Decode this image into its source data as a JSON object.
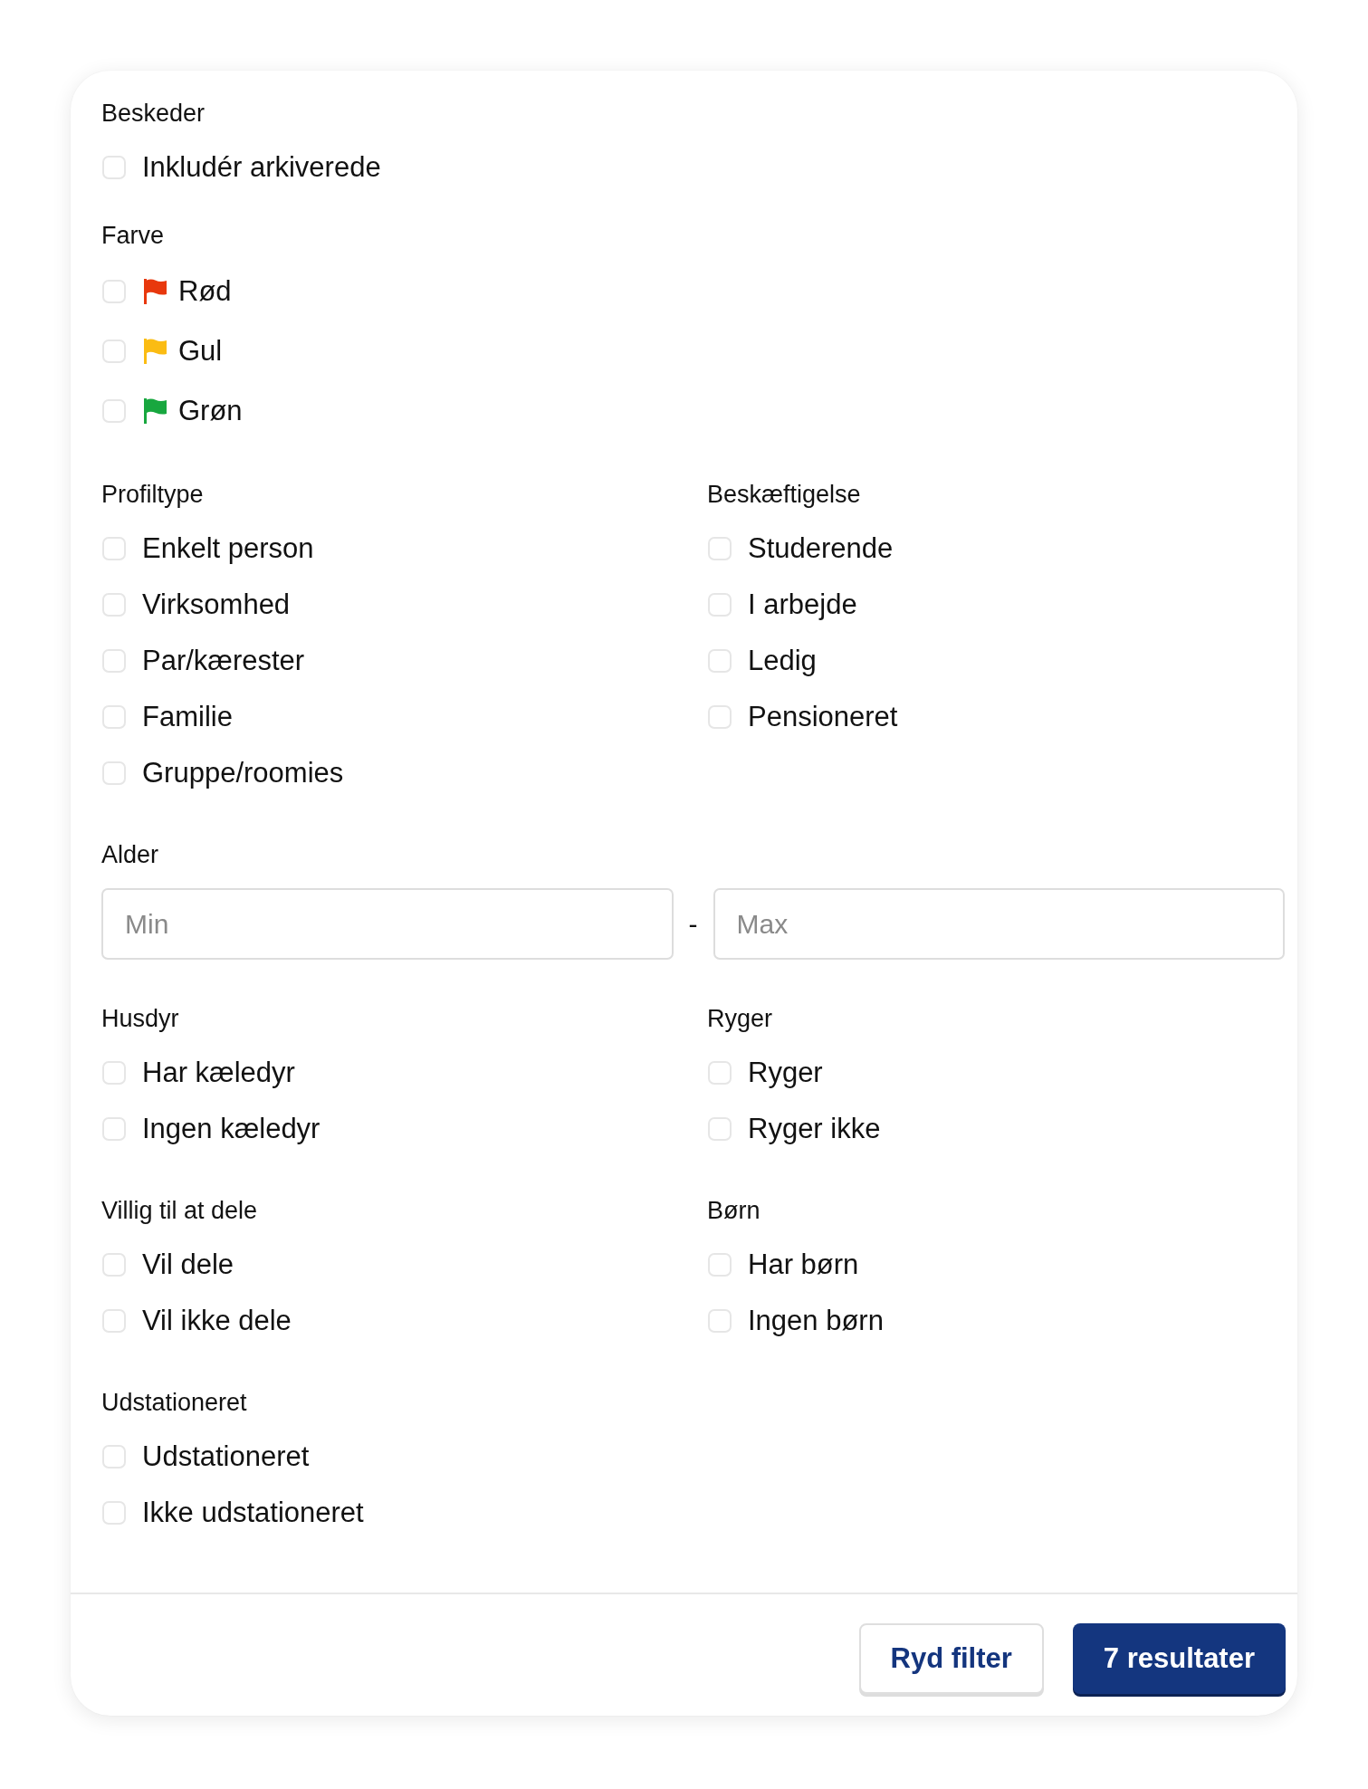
{
  "filters": [
    {
      "kind": "checkboxes",
      "groups": [
        {
          "title": "Beskeder",
          "options": [
            {
              "label": "Inkludér arkiverede",
              "checked": false
            }
          ]
        }
      ]
    },
    {
      "kind": "checkboxes",
      "groups": [
        {
          "title": "Farve",
          "options": [
            {
              "label": "Rød",
              "checked": false,
              "color": "#e8380d"
            },
            {
              "label": "Gul",
              "checked": false,
              "color": "#fbbc13"
            },
            {
              "label": "Grøn",
              "checked": false,
              "color": "#18a73f"
            }
          ]
        }
      ]
    },
    {
      "kind": "checkboxes",
      "groups": [
        {
          "title": "Profiltype",
          "options": [
            {
              "label": "Enkelt person",
              "checked": false
            },
            {
              "label": "Virksomhed",
              "checked": false
            },
            {
              "label": "Par/kærester",
              "checked": false
            },
            {
              "label": "Familie",
              "checked": false
            },
            {
              "label": "Gruppe/roomies",
              "checked": false
            }
          ]
        },
        {
          "title": "Beskæftigelse",
          "options": [
            {
              "label": "Studerende",
              "checked": false
            },
            {
              "label": "I arbejde",
              "checked": false
            },
            {
              "label": "Ledig",
              "checked": false
            },
            {
              "label": "Pensioneret",
              "checked": false
            }
          ]
        }
      ]
    },
    {
      "kind": "range",
      "title": "Alder",
      "min": {
        "placeholder": "Min"
      },
      "separator": "-",
      "max": {
        "placeholder": "Max"
      }
    },
    {
      "kind": "checkboxes",
      "groups": [
        {
          "title": "Husdyr",
          "options": [
            {
              "label": "Har kæledyr",
              "checked": false
            },
            {
              "label": "Ingen kæledyr",
              "checked": false
            }
          ]
        },
        {
          "title": "Ryger",
          "options": [
            {
              "label": "Ryger",
              "checked": false
            },
            {
              "label": "Ryger ikke",
              "checked": false
            }
          ]
        }
      ]
    },
    {
      "kind": "checkboxes",
      "groups": [
        {
          "title": "Villig til at dele",
          "options": [
            {
              "label": "Vil dele",
              "checked": false
            },
            {
              "label": "Vil ikke dele",
              "checked": false
            }
          ]
        },
        {
          "title": "Børn",
          "options": [
            {
              "label": "Har børn",
              "checked": false
            },
            {
              "label": "Ingen børn",
              "checked": false
            }
          ]
        }
      ]
    },
    {
      "kind": "checkboxes",
      "groups": [
        {
          "title": "Udstationeret",
          "options": [
            {
              "label": "Udstationeret",
              "checked": false
            },
            {
              "label": "Ikke udstationeret",
              "checked": false
            }
          ]
        }
      ]
    }
  ],
  "actions": [
    {
      "label": "Ryd filter",
      "kind": "secondary"
    },
    {
      "label": "7 resultater",
      "kind": "primary"
    }
  ]
}
